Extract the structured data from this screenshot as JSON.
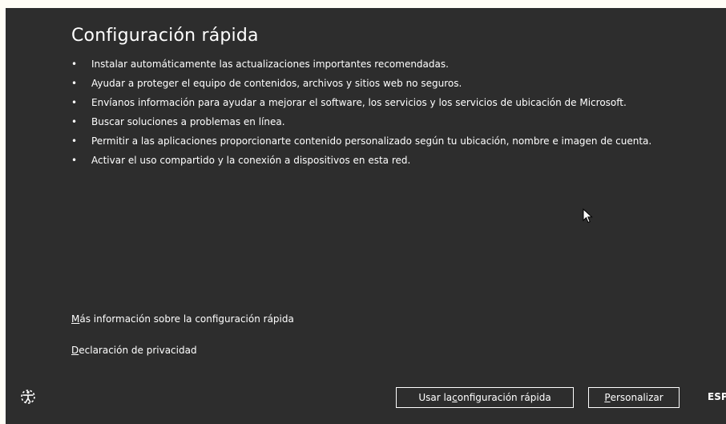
{
  "page": {
    "title": "Configuración rápida",
    "bullet_glyph": "•",
    "bullets": [
      "Instalar automáticamente las actualizaciones importantes recomendadas.",
      "Ayudar a proteger el equipo de contenidos, archivos y sitios web no seguros.",
      "Envíanos información para ayudar a mejorar el software, los servicios y los servicios de ubicación de Microsoft.",
      "Buscar soluciones a problemas en línea.",
      "Permitir a las aplicaciones proporcionarte contenido personalizado según tu ubicación, nombre e imagen de cuenta.",
      "Activar el uso compartido y la conexión a dispositivos en esta red."
    ]
  },
  "links": {
    "more_info": {
      "access_key": "M",
      "rest": "ás información sobre la configuración rápida"
    },
    "privacy": {
      "access_key": "D",
      "rest": "eclaración de privacidad"
    }
  },
  "footer": {
    "express_button": {
      "before": "Usar la ",
      "access_key": "c",
      "after": "onfiguración rápida"
    },
    "customize_button": {
      "access_key": "P",
      "rest": "ersonalizar"
    },
    "language": "ESP",
    "ease_of_access_icon": "ease-of-access-icon",
    "cursor_icon": "mouse-pointer-icon"
  },
  "colors": {
    "background": "#2d2d2d",
    "text": "#ffffff",
    "outer_frame": "#fffdf6"
  }
}
